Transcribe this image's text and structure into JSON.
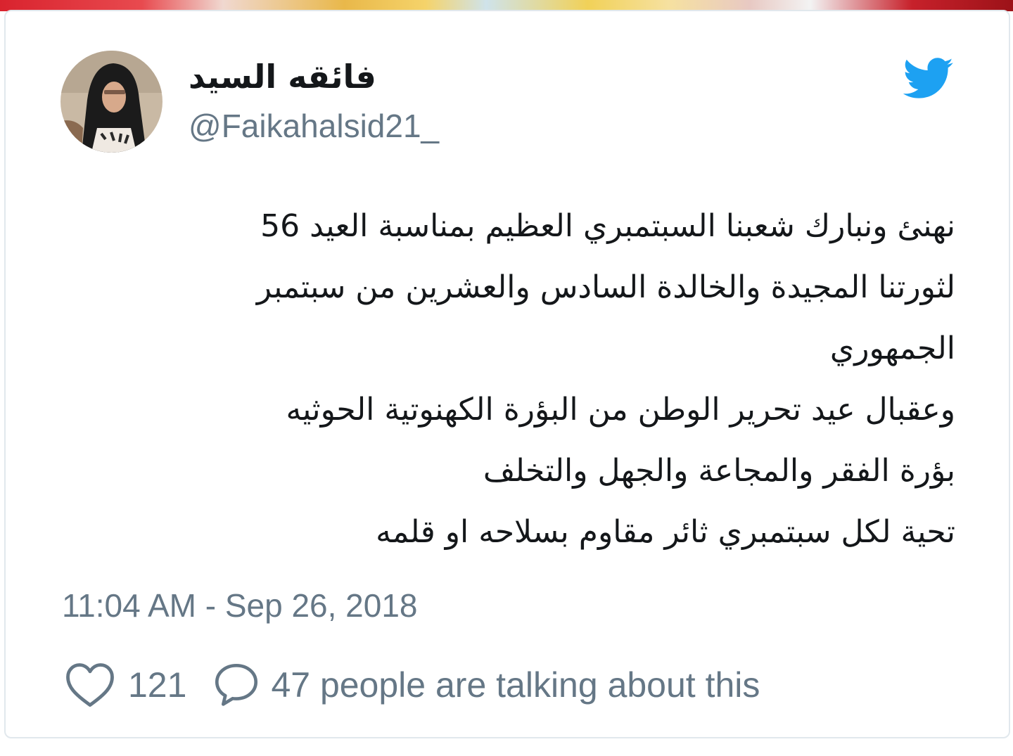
{
  "tweet": {
    "author": {
      "display_name": "فائقه السيد",
      "handle": "@Faikahalsid21_"
    },
    "text_lines": [
      "نهنئ ونبارك شعبنا السبتمبري العظيم بمناسبة العيد 56",
      "لثورتنا المجيدة والخالدة السادس والعشرين من سبتمبر",
      "الجمهوري",
      "وعقبال عيد تحرير الوطن من البؤرة الكهنوتية الحوثيه",
      "بؤرة الفقر والمجاعة والجهل والتخلف",
      "تحية لكل سبتمبري ثائر مقاوم بسلاحه او قلمه"
    ],
    "timestamp": "11:04 AM - Sep 26, 2018",
    "likes_count": "121",
    "talking_text": "47 people are talking about this"
  },
  "icons": {
    "brand": "twitter-bird-icon",
    "like": "heart-icon",
    "reply": "comment-bubble-icon"
  },
  "colors": {
    "twitter_blue": "#1da1f2",
    "text": "#14171a",
    "secondary": "#657786",
    "border": "#e1e8ed"
  }
}
